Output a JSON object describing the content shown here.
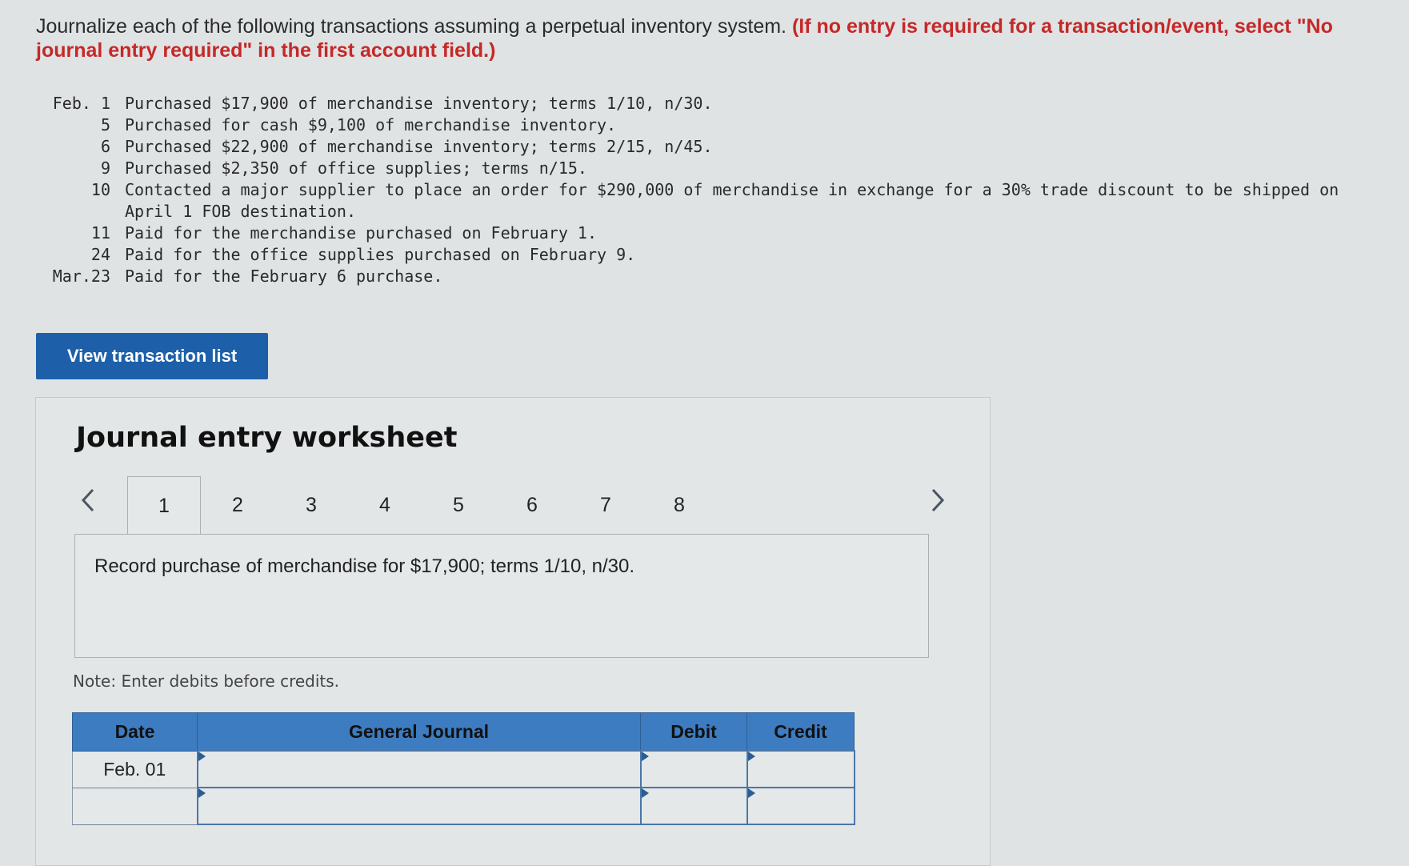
{
  "instructions": {
    "plain": "Journalize each of the following transactions assuming a perpetual inventory system.",
    "warning": "(If no entry is required for a transaction/event, select \"No journal entry required\" in the first account field.)"
  },
  "transactions": [
    {
      "date": "Feb. 1",
      "text": "Purchased $17,900 of merchandise inventory; terms 1/10, n/30."
    },
    {
      "date": "5",
      "text": "Purchased for cash $9,100 of merchandise inventory."
    },
    {
      "date": "6",
      "text": "Purchased $22,900 of merchandise inventory; terms 2/15, n/45."
    },
    {
      "date": "9",
      "text": "Purchased $2,350 of office supplies; terms n/15."
    },
    {
      "date": "10",
      "text": "Contacted a major supplier to place an order for $290,000 of merchandise in exchange for a 30% trade discount to be shipped on April 1 FOB destination."
    },
    {
      "date": "11",
      "text": "Paid for the merchandise purchased on February 1."
    },
    {
      "date": "24",
      "text": "Paid for the office supplies purchased on February 9."
    },
    {
      "date": "Mar.23",
      "text": "Paid for the February 6 purchase."
    }
  ],
  "view_button_label": "View transaction list",
  "worksheet": {
    "title": "Journal entry worksheet",
    "tabs": [
      "1",
      "2",
      "3",
      "4",
      "5",
      "6",
      "7",
      "8"
    ],
    "active_tab": "1",
    "prev_icon": "chevron-left-icon",
    "next_icon": "chevron-right-icon",
    "description": "Record purchase of merchandise for $17,900; terms 1/10, n/30.",
    "note": "Note: Enter debits before credits.",
    "table": {
      "headers": {
        "date": "Date",
        "general_journal": "General Journal",
        "debit": "Debit",
        "credit": "Credit"
      },
      "rows": [
        {
          "date": "Feb. 01",
          "account": "",
          "debit": "",
          "credit": ""
        },
        {
          "date": "",
          "account": "",
          "debit": "",
          "credit": ""
        }
      ]
    }
  },
  "colors": {
    "warning": "#c62828",
    "button": "#1d5fa8",
    "table_header": "#3d7cc0"
  }
}
